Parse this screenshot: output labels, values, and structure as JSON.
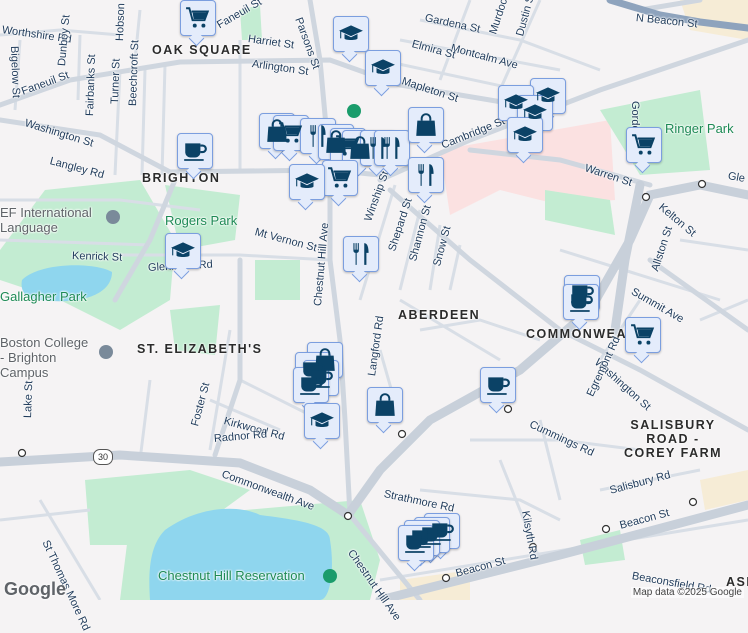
{
  "map": {
    "neighborhoods": [
      "OAK SQUARE",
      "BRIGHTON",
      "ST. ELIZABETH'S",
      "ABERDEEN",
      "COMMONWEA",
      "SALISBURY ROAD - COREY FARM",
      "ASP"
    ],
    "parks": [
      "Rogers Park",
      "Ringer Park",
      "Gallagher Park",
      "Chestnut Hill Reservation"
    ],
    "pois": [
      "EF International Language Campus...",
      "Boston College - Brighton Campus"
    ],
    "streets": [
      "Worthshire Rd",
      "Dunboy St",
      "Bigelow St",
      "Hobson St",
      "Faneuil St",
      "Harriet St",
      "Parsons St",
      "Arlington St",
      "Faneuil St",
      "Fairbanks St",
      "Turner St",
      "Beechcroft St",
      "Washington St",
      "Langley Rd",
      "Mt Vernon St",
      "Kenrick St",
      "Glenmont Rd",
      "Gardena St",
      "Montcalm Ave",
      "Elmira St",
      "Mapleton St",
      "Murdock St",
      "Dustin St",
      "N Beacon St",
      "Cambridge St",
      "Warren St",
      "Gordon St",
      "Winship St",
      "Shepard St",
      "Shannon St",
      "Snow St",
      "Kelton St",
      "Allston St",
      "Summit Ave",
      "Chestnut Hill Ave",
      "Washington St",
      "Egremont Rd",
      "Cummings Rd",
      "Kilsyth Rd",
      "Strathmore Rd",
      "Salisbury Rd",
      "Beacon St",
      "Beacon St",
      "Lake St",
      "Foster St",
      "Kirkwood Rd",
      "Radnor Rd",
      "Commonwealth Ave",
      "St Thomas More Rd",
      "Chestnut Hill Ave",
      "Langford Rd",
      "Beaconsfield Rd",
      "Gle"
    ],
    "route_shield": "30",
    "attribution": "Map data ©2025 Google",
    "logo": "Google"
  },
  "colors": {
    "marker_bg": "#e4ecfb",
    "marker_border": "#7b9edf",
    "icon": "#0b4266",
    "water": "#8fd6ee",
    "park": "#c3ecd2"
  }
}
